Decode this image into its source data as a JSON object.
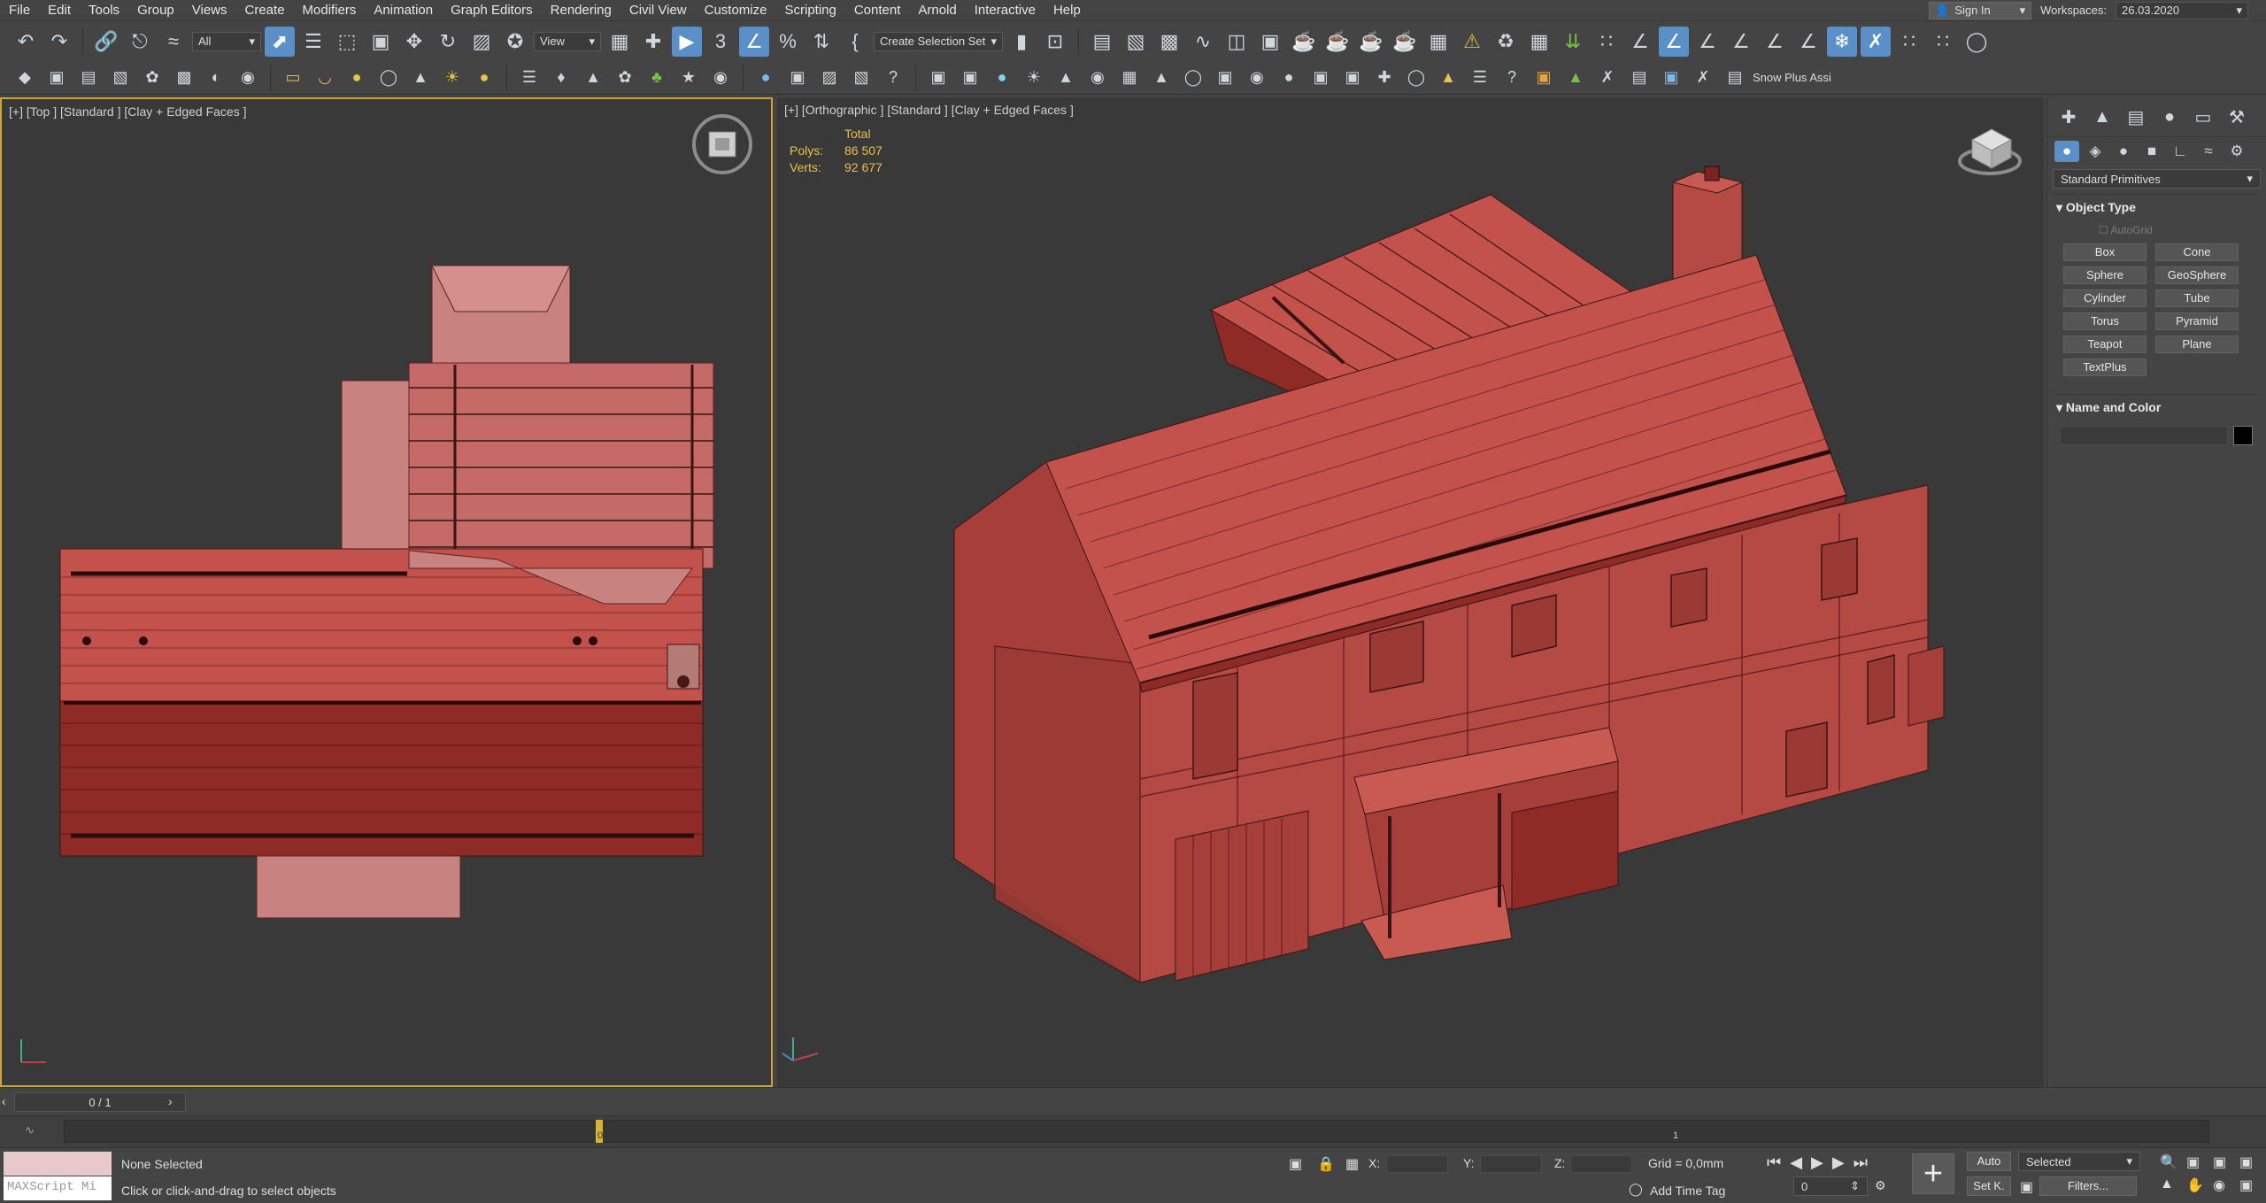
{
  "menu": [
    "File",
    "Edit",
    "Tools",
    "Group",
    "Views",
    "Create",
    "Modifiers",
    "Animation",
    "Graph Editors",
    "Rendering",
    "Civil View",
    "Customize",
    "Scripting",
    "Content",
    "Arnold",
    "Interactive",
    "Help"
  ],
  "signin": "Sign In",
  "workspaces": {
    "label": "Workspaces:",
    "value": "26.03.2020"
  },
  "toolbar": {
    "selection_filter": "All",
    "ref_coord": "View",
    "named_selection": "Create Selection Set",
    "snow_plus": "Snow Plus Assi"
  },
  "viewport_left": {
    "label": "[+] [Top ] [Standard ] [Clay + Edged Faces ]"
  },
  "viewport_right": {
    "label": "[+] [Orthographic ] [Standard ] [Clay + Edged Faces ]",
    "stats": {
      "header": "Total",
      "polys_label": "Polys:",
      "polys": "86 507",
      "verts_label": "Verts:",
      "verts": "92 677"
    }
  },
  "command_panel": {
    "category": "Standard Primitives",
    "object_type_title": "Object Type",
    "autogrid": "AutoGrid",
    "buttons": [
      "Box",
      "Cone",
      "Sphere",
      "GeoSphere",
      "Cylinder",
      "Tube",
      "Torus",
      "Pyramid",
      "Teapot",
      "Plane",
      "TextPlus"
    ],
    "name_color_title": "Name and Color",
    "color": "#000000"
  },
  "time": {
    "frame": "0 / 1",
    "tick_0": "0",
    "tick_1": "1"
  },
  "status": {
    "maxscript": "MAXScript Mi",
    "selection": "None Selected",
    "prompt": "Click or click-and-drag to select objects",
    "x_label": "X:",
    "y_label": "Y:",
    "z_label": "Z:",
    "grid": "Grid = 0,0mm",
    "add_time_tag": "Add Time Tag",
    "auto": "Auto",
    "set_key": "Set K.",
    "key_filter": "Selected",
    "frame_value": "0",
    "filters": "Filters..."
  },
  "colors": {
    "model": "#b54a44",
    "model_dark": "#7a2321",
    "roof_light": "#c95a52",
    "selection_border": "#c9a43c",
    "accent": "#5a8fc8"
  }
}
